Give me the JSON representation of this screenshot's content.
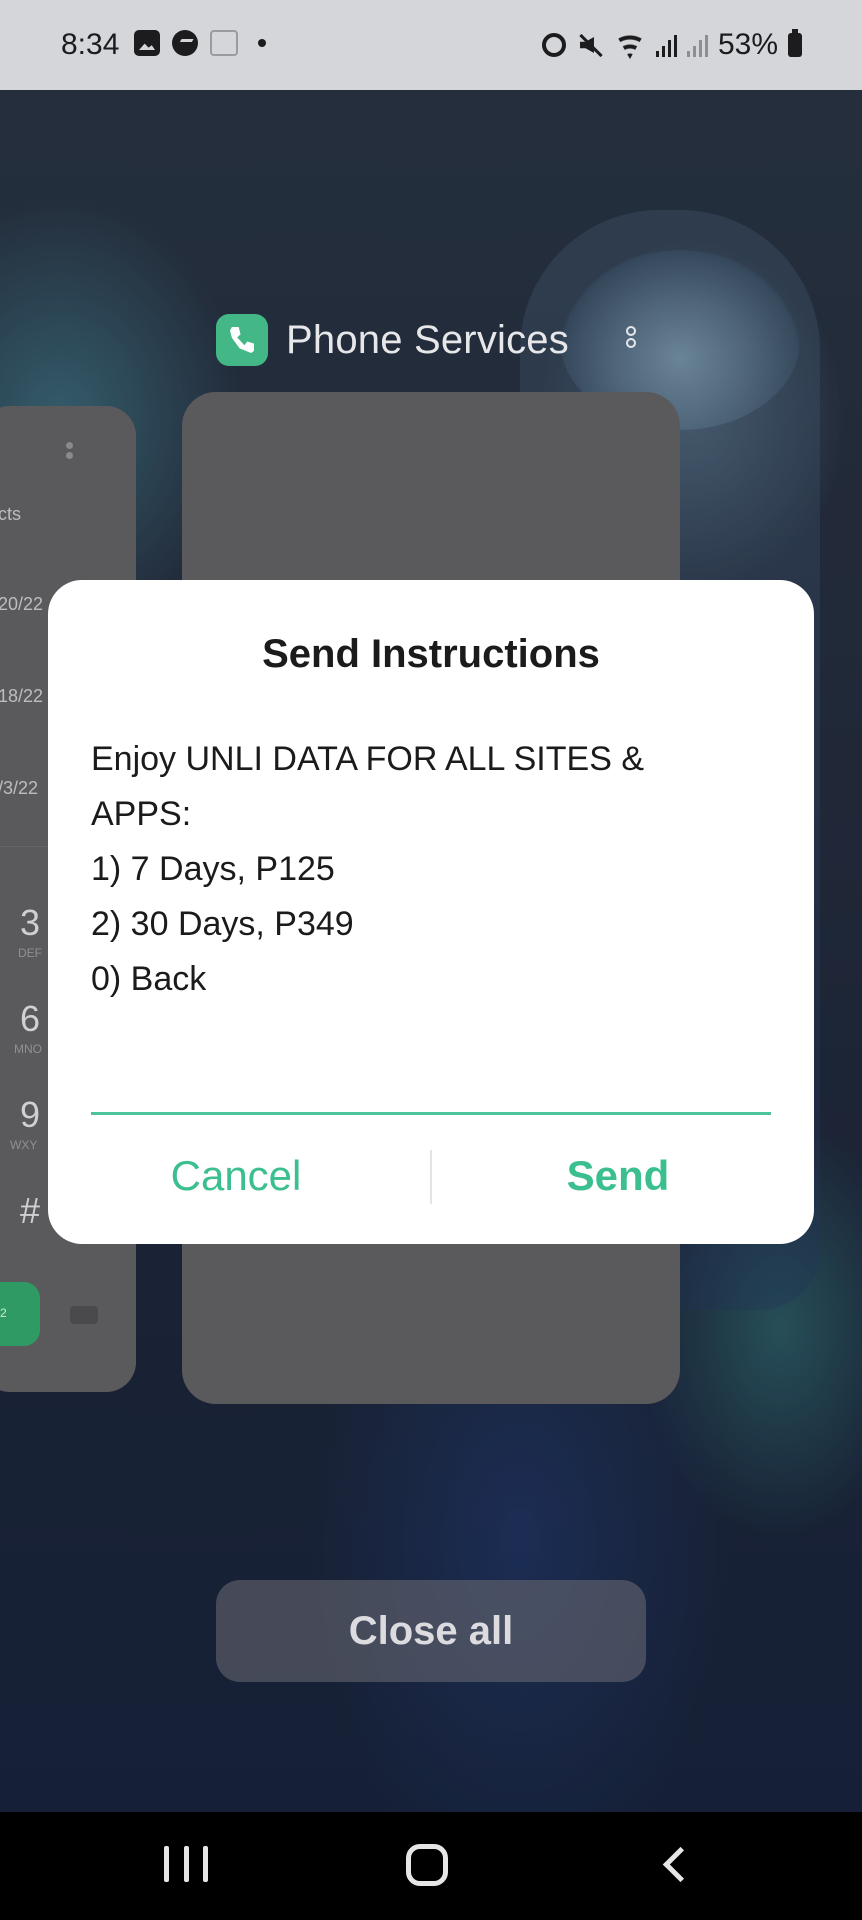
{
  "status_bar": {
    "time": "8:34",
    "left_icons": [
      "gallery-icon",
      "messenger-icon",
      "grid-app-icon",
      "notification-dot"
    ],
    "right_icons": [
      "alarm-icon",
      "mute-icon",
      "wifi-icon",
      "signal-icon",
      "signal-icon"
    ],
    "battery": "53%"
  },
  "recents": {
    "app_title": "Phone Services",
    "app_icon": "phone-icon",
    "left_card": {
      "fragments": [
        "cts",
        "20/22",
        "18/22",
        "/3/22",
        "3",
        "DEF",
        "6",
        "MNO",
        "9",
        "WXY",
        "#",
        "2"
      ]
    },
    "close_all_label": "Close all"
  },
  "dialog": {
    "title": "Send Instructions",
    "message_lines": [
      "Enjoy UNLI DATA FOR ALL SITES &",
      "APPS:",
      "1) 7 Days, P125",
      "2) 30 Days, P349",
      "0) Back"
    ],
    "input_value": "",
    "cancel_label": "Cancel",
    "send_label": "Send"
  },
  "colors": {
    "accent": "#3cbf8e",
    "app_icon_bg": "#43b886",
    "status_bar_bg": "#d5d6da",
    "nav_bar_bg": "#000000"
  },
  "nav_bar": {
    "buttons": [
      "recents-button",
      "home-button",
      "back-button"
    ]
  }
}
